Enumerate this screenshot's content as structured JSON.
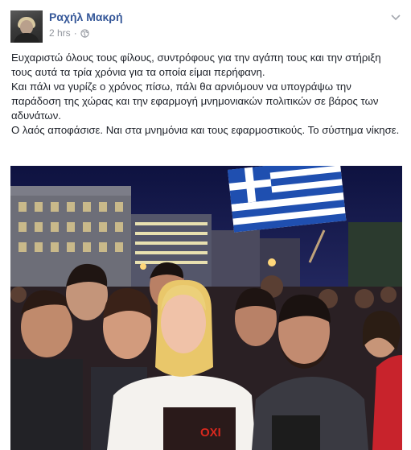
{
  "post": {
    "author": "Ραχήλ Μακρή",
    "time": "2 hrs",
    "separator": "·",
    "paragraphs": [
      "Ευχαριστώ όλους τους φίλους, συντρόφους για την αγάπη τους και την στήριξη τους αυτά τα τρία χρόνια για τα οποία είμαι περήφανη.",
      "Και πάλι να γυρίζε ο χρόνος πίσω, πάλι θα αρνιόμουν να υπογράψω την παράδοση της χώρας και την εφαρμογή μνημονιακών πολιτικών σε βάρος των αδυνάτων.",
      "Ο λαός αποφάσισε. Ναι στα μνημόνια και τους εφαρμοστικούς. Το σύστημα νίκησε."
    ],
    "photo_shirt_text": "OXI"
  },
  "colors": {
    "author_link": "#365899",
    "meta_text": "#90949c",
    "flag_blue": "#1f4fb0"
  },
  "icons": [
    "globe-icon",
    "chevron-down-icon"
  ]
}
